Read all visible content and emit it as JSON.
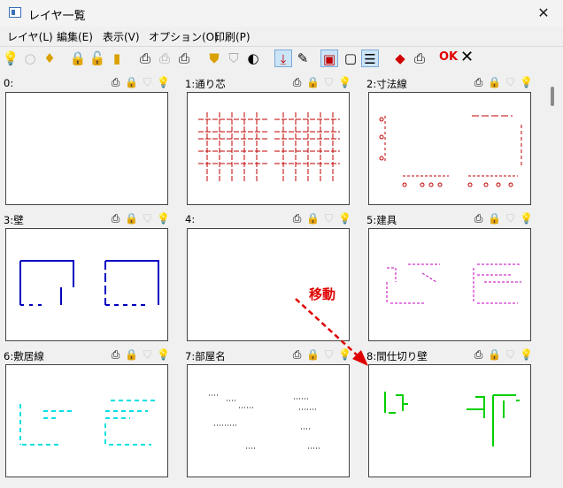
{
  "window": {
    "title": "レイヤ一覧",
    "close_glyph": "✕"
  },
  "menu": [
    {
      "label": "レイヤ(L)"
    },
    {
      "label": "編集(E)"
    },
    {
      "label": "表示(V)"
    },
    {
      "label": "オプション(O)"
    },
    {
      "label": "印刷(P)"
    }
  ],
  "toolbar": {
    "icons": [
      "bulb-on-icon",
      "bulb-off-icon",
      "bulb-dim-icon",
      "lock-icon",
      "lock-open-icon",
      "lock-dim-icon",
      "printer-icon",
      "printer-dim-icon",
      "printer-mixed-icon",
      "shield-icon",
      "shield-dim-icon",
      "shield-half-icon",
      "download-tray-icon",
      "edit-pen-icon",
      "frame-red-icon",
      "frame-icon",
      "list-icon",
      "eraser-icon",
      "printer-color-icon"
    ],
    "ok_label": "OK",
    "cancel_glyph": "✕"
  },
  "annotation": {
    "text": "移動",
    "color": "#e00000"
  },
  "layers": [
    {
      "label": "0:",
      "color": "#000000"
    },
    {
      "label": "1:通り芯",
      "color": "#c00000"
    },
    {
      "label": "2:寸法線",
      "color": "#c00000"
    },
    {
      "label": "3:壁",
      "color": "#0000c0"
    },
    {
      "label": "4:",
      "color": "#000000"
    },
    {
      "label": "5:建具",
      "color": "#c000c0"
    },
    {
      "label": "6:敷居線",
      "color": "#00e0e0"
    },
    {
      "label": "7:部屋名",
      "color": "#000000"
    },
    {
      "label": "8:間仕切り壁",
      "color": "#00d000"
    }
  ]
}
